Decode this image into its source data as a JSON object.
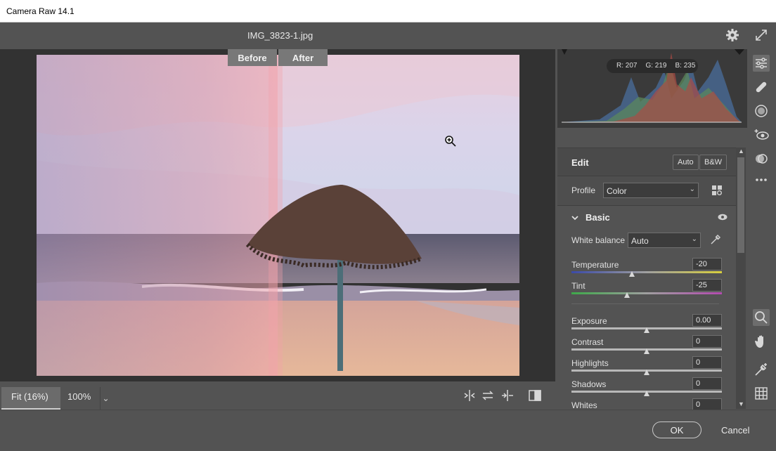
{
  "window": {
    "title": "Camera Raw 14.1"
  },
  "topbar": {
    "filename": "IMG_3823-1.jpg"
  },
  "preview": {
    "before_label": "Before",
    "after_label": "After"
  },
  "viewbar": {
    "fit_label": "Fit (16%)",
    "zoom_label": "100%"
  },
  "histogram": {
    "r": "R: 207",
    "g": "G: 219",
    "b": "B: 235"
  },
  "edit": {
    "title": "Edit",
    "auto_label": "Auto",
    "bw_label": "B&W",
    "profile_label": "Profile",
    "profile_value": "Color"
  },
  "basic": {
    "title": "Basic",
    "white_balance_label": "White balance",
    "white_balance_value": "Auto",
    "sliders": [
      {
        "label": "Temperature",
        "value": "-20",
        "fraction": 0.4
      },
      {
        "label": "Tint",
        "value": "-25",
        "fraction": 0.37
      },
      {
        "label": "Exposure",
        "value": "0.00",
        "fraction": 0.5
      },
      {
        "label": "Contrast",
        "value": "0",
        "fraction": 0.5
      },
      {
        "label": "Highlights",
        "value": "0",
        "fraction": 0.5
      },
      {
        "label": "Shadows",
        "value": "0",
        "fraction": 0.5
      },
      {
        "label": "Whites",
        "value": "0",
        "fraction": 0.5
      }
    ]
  },
  "footer": {
    "ok_label": "OK",
    "cancel_label": "Cancel"
  },
  "colors": {
    "panel": "#535353",
    "canvas": "#323232",
    "accent": "#cfcfcf"
  }
}
